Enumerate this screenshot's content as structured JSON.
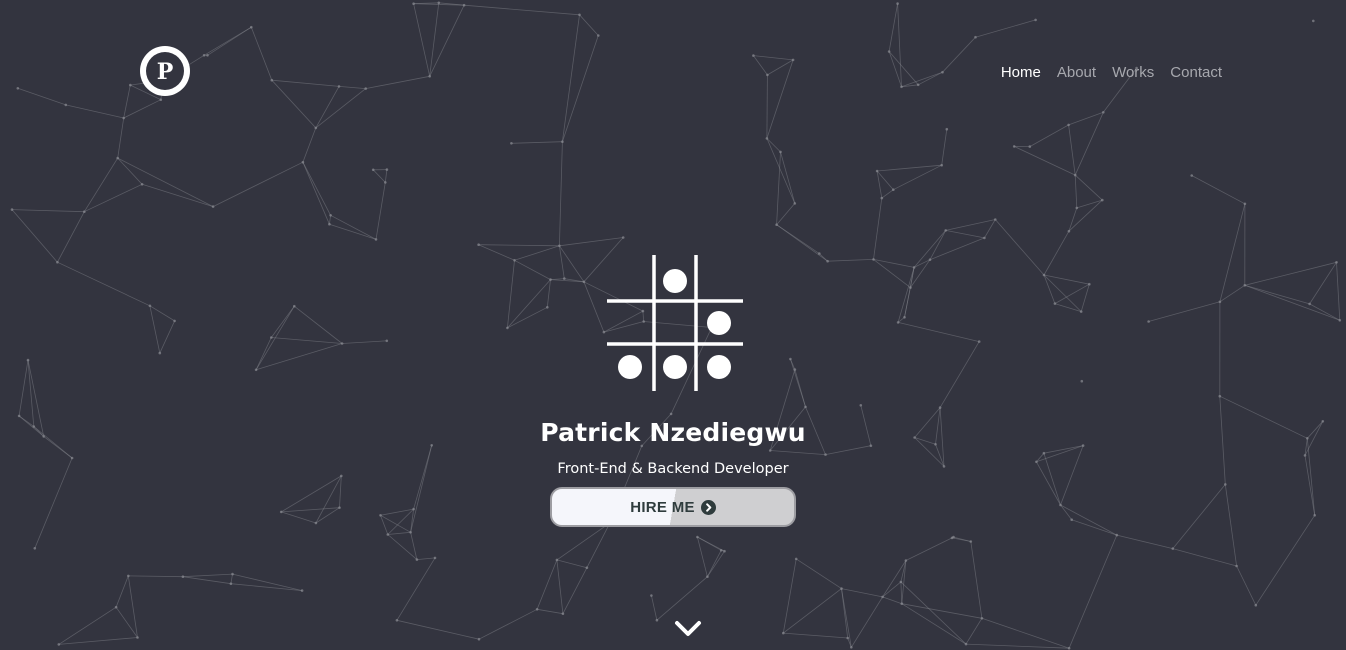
{
  "brand": {
    "logo_letter": "P",
    "logo_icon": "p-monogram-icon"
  },
  "nav": {
    "items": [
      {
        "label": "Home",
        "active": true
      },
      {
        "label": "About",
        "active": false
      },
      {
        "label": "Works",
        "active": false
      },
      {
        "label": "Contact",
        "active": false
      }
    ]
  },
  "hero": {
    "icon": "tic-tac-toe-grid-icon",
    "name": "Patrick Nzediegwu",
    "role": "Front-End & Backend Developer",
    "cta_label": "HIRE ME",
    "cta_icon": "chevron-right-circle-icon",
    "scroll_icon": "chevron-down-icon"
  },
  "colors": {
    "background": "#33343f",
    "text": "#ffffff",
    "nav_inactive": "#a7a8ae",
    "network_lines": "#8a8b93",
    "button_dark": "#2f3c3d"
  }
}
